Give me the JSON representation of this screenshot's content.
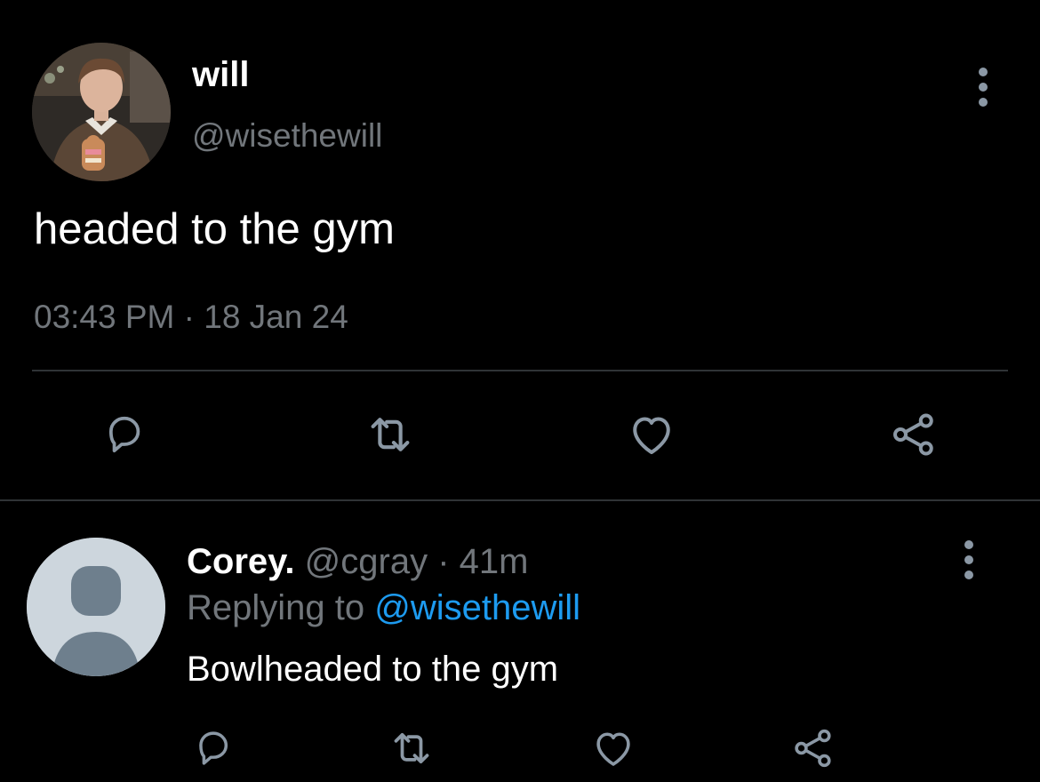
{
  "tweet": {
    "author_name": "will",
    "author_handle": "@wisethewill",
    "text": "headed to the gym",
    "timestamp": "03:43 PM · 18 Jan 24",
    "actions": [
      "reply-icon",
      "retweet-icon",
      "like-icon",
      "share-icon"
    ]
  },
  "reply": {
    "author_name": "Corey.",
    "author_handle": "@cgray",
    "separator": "·",
    "time_ago": "41m",
    "replying_prefix": "Replying to",
    "replying_to": "@wisethewill",
    "text": "Bowlheaded to the gym",
    "actions": [
      "reply-icon",
      "retweet-icon",
      "like-icon",
      "share-icon"
    ]
  },
  "colors": {
    "background": "#000000",
    "text_primary": "#ffffff",
    "text_secondary": "#71767b",
    "link": "#1d9bf0",
    "divider": "#2f3336",
    "icon": "#8b98a5",
    "default_avatar_bg": "#cdd6dd",
    "default_avatar_fg": "#6e7f8d"
  }
}
